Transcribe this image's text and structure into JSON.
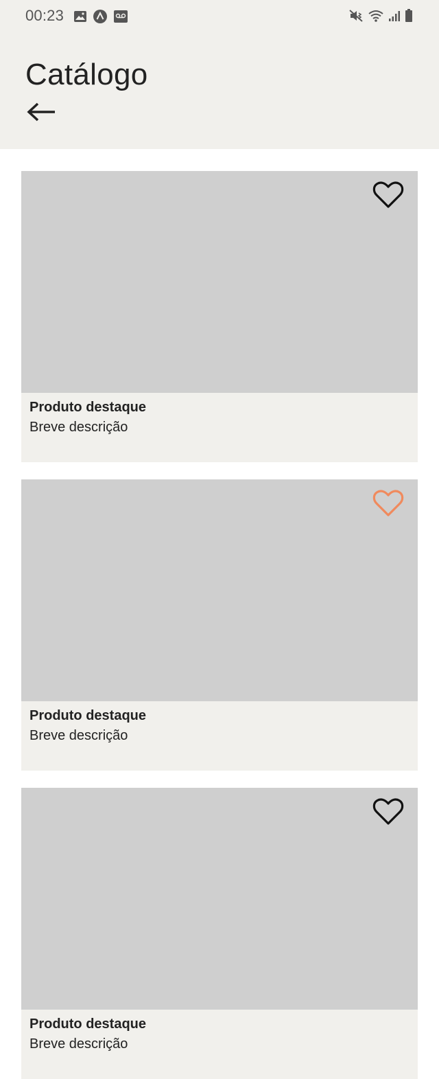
{
  "status_bar": {
    "time": "00:23",
    "left_icons": [
      "gallery-icon",
      "app-launcher-icon",
      "voicemail-icon"
    ],
    "right_icons": [
      "mute-vibrate-icon",
      "wifi-icon",
      "signal-icon",
      "battery-icon"
    ]
  },
  "header": {
    "title": "Catálogo",
    "back_icon": "arrow-left-icon"
  },
  "colors": {
    "header_bg": "#f1f0ec",
    "image_placeholder": "#cfcfcf",
    "favorite_active": "#f08a5d",
    "favorite_inactive": "#111111"
  },
  "products": [
    {
      "title": "Produto destaque",
      "description": "Breve descrição",
      "favorite": false
    },
    {
      "title": "Produto destaque",
      "description": "Breve descrição",
      "favorite": true
    },
    {
      "title": "Produto destaque",
      "description": "Breve descrição",
      "favorite": false
    }
  ]
}
